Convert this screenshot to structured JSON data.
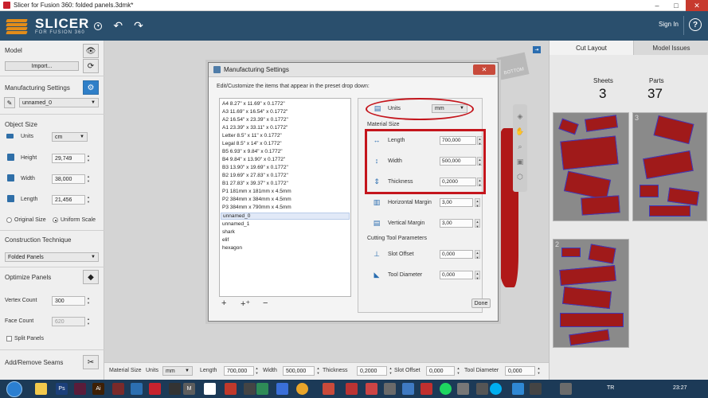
{
  "window": {
    "title": "Slicer for Fusion 360: folded panels.3dmk*",
    "min": "–",
    "max": "□",
    "close": "✕"
  },
  "appbar": {
    "logo_big": "SLICER",
    "logo_small": "FOR FUSION 360",
    "sign_in": "Sign In",
    "help": "?",
    "undo_icon": "undo-arrow",
    "redo_icon": "redo-arrow"
  },
  "left": {
    "model_heading": "Model",
    "import_btn": "Import...",
    "mfg_heading": "Manufacturing Settings",
    "preset_value": "unnamed_0",
    "object_size_heading": "Object Size",
    "units_label": "Units",
    "units_value": "cm",
    "height_label": "Height",
    "height_value": "29,749",
    "width_label": "Width",
    "width_value": "38,000",
    "length_label": "Length",
    "length_value": "21,456",
    "original_size": "Original Size",
    "uniform_scale": "Uniform Scale",
    "construction_heading": "Construction Technique",
    "construction_value": "Folded Panels",
    "optimize_heading": "Optimize Panels",
    "vertex_label": "Vertex Count",
    "vertex_value": "300",
    "face_label": "Face Count",
    "face_value": "620",
    "split_panels": "Split Panels",
    "seams_heading": "Add/Remove Seams"
  },
  "viewcube_label": "BOTTOM",
  "bottom": {
    "material_size": "Material Size",
    "units": "Units",
    "units_value": "mm",
    "length": "Length",
    "length_value": "700,000",
    "width": "Width",
    "width_value": "500,000",
    "thickness": "Thickness",
    "thickness_value": "0,2000",
    "slot_offset": "Slot Offset",
    "slot_value": "0,000",
    "tool_diameter": "Tool Diameter",
    "tool_value": "0,000"
  },
  "right": {
    "tab_cut": "Cut Layout",
    "tab_issues": "Model Issues",
    "sheets_label": "Sheets",
    "sheets_value": "3",
    "parts_label": "Parts",
    "parts_value": "37",
    "sheet_nums": [
      "3",
      "2"
    ]
  },
  "dialog": {
    "title": "Manufacturing Settings",
    "description": "Edit/Customize the items that appear in the preset drop down:",
    "presets": [
      "A4 8.27\" x 11.69\" x 0.1772\"",
      "A3 11.69\" x 16.54\" x 0.1772\"",
      "A2 16.54\" x 23.39\" x 0.1772\"",
      "A1 23.39\" x 33.11\" x 0.1772\"",
      "Letter 8.5\" x 11\" x 0.1772\"",
      "Legal 8.5\" x 14\" x 0.1772\"",
      "B5 6.93\" x 9.84\" x 0.1772\"",
      "B4 9.84\" x 13.90\" x 0.1772\"",
      "B3 13.90\" x 19.69\" x 0.1772\"",
      "B2 19.69\" x 27.83\" x 0.1772\"",
      "B1 27.83\" x 39.37\" x 0.1772\"",
      "P1 181mm x 181mm x 4.5mm",
      "P2 384mm x 384mm x 4.5mm",
      "P3 384mm x 790mm x 4.5mm",
      "unnamed_0",
      "unnamed_1",
      "shark",
      "elif",
      "hexagon"
    ],
    "selected_index": 14,
    "units_label": "Units",
    "units_value": "mm",
    "material_size_heading": "Material Size",
    "length_label": "Length",
    "length_value": "700,000",
    "width_label": "Width",
    "width_value": "500,000",
    "thickness_label": "Thickness",
    "thickness_value": "0,2000",
    "hmargin_label": "Horizontal Margin",
    "hmargin_value": "3,00",
    "vmargin_label": "Vertical Margin",
    "vmargin_value": "3,00",
    "cutting_heading": "Cutting Tool Parameters",
    "slot_label": "Slot Offset",
    "slot_value": "0,000",
    "tool_label": "Tool Diameter",
    "tool_value": "0,000",
    "add_icon": "+",
    "add_multi_icon": "+⁺",
    "remove_icon": "−",
    "done": "Done"
  },
  "taskbar": {
    "lang": "TR",
    "time": "23:27"
  },
  "colors": {
    "accent": "#2a4f6d",
    "highlight": "#c4151c",
    "model": "#a01a1a"
  }
}
